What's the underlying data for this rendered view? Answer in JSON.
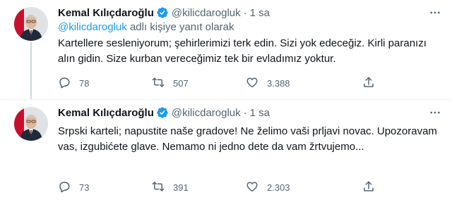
{
  "colors": {
    "text": "#0f1419",
    "secondary": "#536471",
    "link": "#1d9bf0",
    "verified": "#1d9bf0",
    "divider": "#eff3f4",
    "thread_line": "#cfd9de"
  },
  "icons": {
    "reply": "comment-bubble-icon",
    "retweet": "retweet-arrows-icon",
    "like": "heart-icon",
    "share": "share-upload-icon",
    "more": "more-dots-icon",
    "verified": "verified-badge-icon"
  },
  "tweets": [
    {
      "author": {
        "name": "Kemal Kılıçdaroğlu",
        "handle": "@kilicdarogluk",
        "time": "1 sa"
      },
      "reply_to": {
        "mention": "@kilicdarogluk",
        "suffix": "adlı kişiye yanıt olarak"
      },
      "text": "Kartellere sesleniyorum; şehirlerimizi terk edin. Sizi yok edeceğiz. Kirli paranızı alın gidin. Size kurban vereceğimiz tek bir evladımız yoktur.",
      "stats": {
        "replies": "78",
        "retweets": "507",
        "likes": "3.388"
      }
    },
    {
      "author": {
        "name": "Kemal Kılıçdaroğlu",
        "handle": "@kilicdarogluk",
        "time": "1 sa"
      },
      "text": "Srpski karteli; napustite naše gradove! Ne želimo vaši prljavi novac. Upozoravam vas, izgubićete glave. Nemamo ni jedno dete da vam žrtvujemo...",
      "stats": {
        "replies": "73",
        "retweets": "391",
        "likes": "2.303"
      }
    }
  ]
}
